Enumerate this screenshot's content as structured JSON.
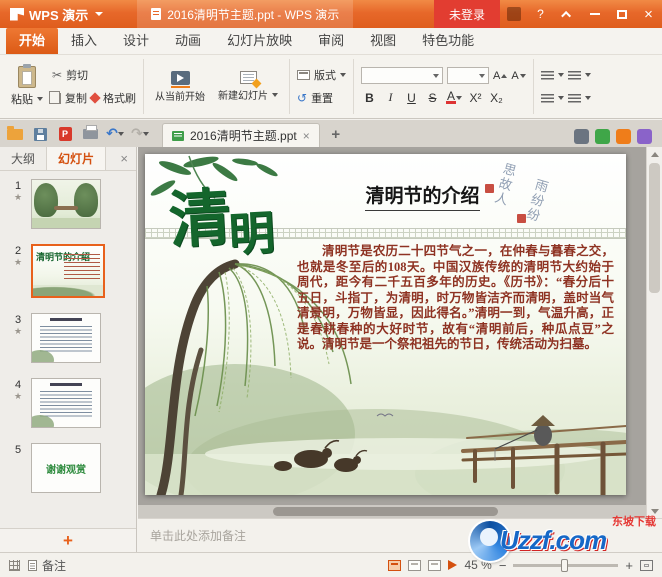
{
  "titlebar": {
    "logo": "WPS 演示",
    "document_title": "2016清明节主题.ppt - WPS 演示",
    "login": "未登录",
    "help": "?"
  },
  "ribbon_tabs": {
    "items": [
      {
        "label": "开始"
      },
      {
        "label": "插入"
      },
      {
        "label": "设计"
      },
      {
        "label": "动画"
      },
      {
        "label": "幻灯片放映"
      },
      {
        "label": "审阅"
      },
      {
        "label": "视图"
      },
      {
        "label": "特色功能"
      }
    ]
  },
  "ribbon": {
    "paste": "粘贴",
    "cut": "剪切",
    "copy": "复制",
    "format_painter": "格式刷",
    "from_current": "从当前开始",
    "new_slide": "新建幻灯片",
    "layout": "版式",
    "reset": "重置",
    "bold": "B",
    "italic": "I",
    "underline": "U",
    "strike": "S",
    "font_color": "A",
    "superscript": "X²",
    "subscript": "X₂",
    "char_a": "A"
  },
  "docbar": {
    "active_tab": "2016清明节主题.ppt"
  },
  "panel": {
    "outline_tab": "大纲",
    "slides_tab": "幻灯片",
    "close": "×",
    "thumbs": [
      {
        "num": "1",
        "star": "★"
      },
      {
        "num": "2",
        "star": "★"
      },
      {
        "num": "3",
        "star": "★"
      },
      {
        "num": "4",
        "star": "★"
      },
      {
        "num": "5",
        "star": "",
        "caption": "谢谢观赏"
      }
    ]
  },
  "slide": {
    "title": "清明节的介绍",
    "cal_1": "清",
    "cal_2": "明",
    "seal_a": "思故人",
    "seal_b": "雨纷纷",
    "body": "清明节是农历二十四节气之一，在仲春与暮春之交，也就是冬至后的108天。中国汉族传统的清明节大约始于周代，距今有二千五百多年的历史。《历书》：“春分后十五日，斗指丁，为清明，时万物皆洁齐而清明，盖时当气清景明，万物皆显，因此得名。”清明一到，气温升高，正是春耕春种的大好时节，故有“清明前后，种瓜点豆”之说。清明节是一个祭祀祖先的节日，传统活动为扫墓。"
  },
  "notes": {
    "placeholder": "单击此处添加备注"
  },
  "status": {
    "notes_label": "备注",
    "zoom": "45 %",
    "zoom_minus": "−",
    "zoom_plus": "+"
  },
  "watermark": {
    "brand": "Uzzf.com",
    "site": "东坡下载"
  }
}
